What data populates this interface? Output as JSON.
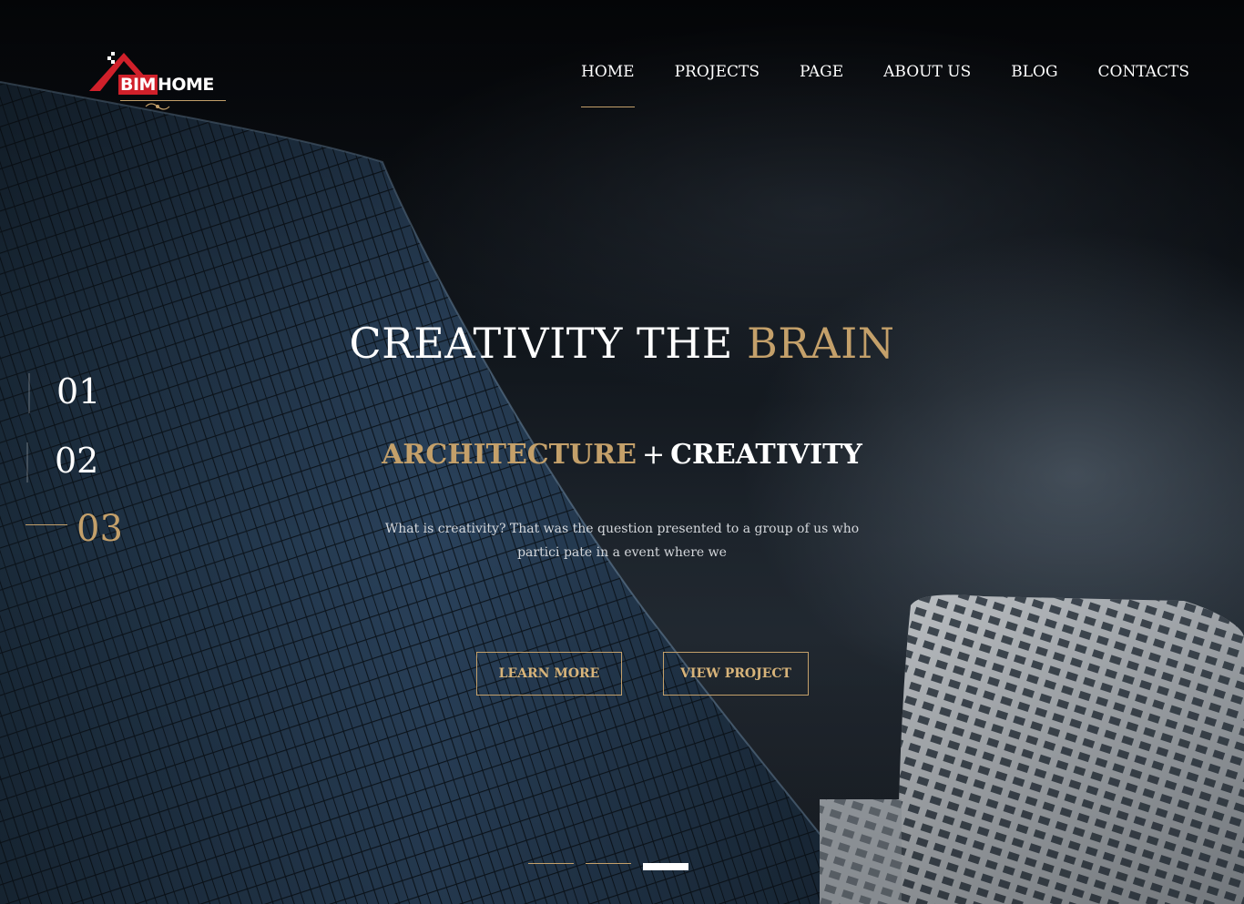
{
  "brand": {
    "bim": "BIM",
    "home": "HOME",
    "accent_color": "#d0202a"
  },
  "nav": {
    "items": [
      {
        "label": "HOME",
        "active": true
      },
      {
        "label": "PROJECTS",
        "active": false
      },
      {
        "label": "PAGE",
        "active": false
      },
      {
        "label": "ABOUT US",
        "active": false
      },
      {
        "label": "BLOG",
        "active": false
      },
      {
        "label": "CONTACTS",
        "active": false
      }
    ]
  },
  "slides": {
    "numbers": [
      "01",
      "02",
      "03"
    ],
    "active_index": 3
  },
  "hero": {
    "title_main": "CREATIVITY THE ",
    "title_accent": "BRAIN",
    "subtitle_accent": "ARCHITECTURE",
    "subtitle_plus": "+",
    "subtitle_main": "CREATIVITY",
    "description": "What is creativity? That was the question presented to a group of us who partici pate in a event where we",
    "learn_more": "LEARN MORE",
    "view_project": "VIEW PROJECT"
  },
  "pagination": {
    "count": 3,
    "active": 3
  },
  "colors": {
    "gold": "#c4a06a",
    "white": "#ffffff",
    "bg_dark": "#0b0f14"
  }
}
